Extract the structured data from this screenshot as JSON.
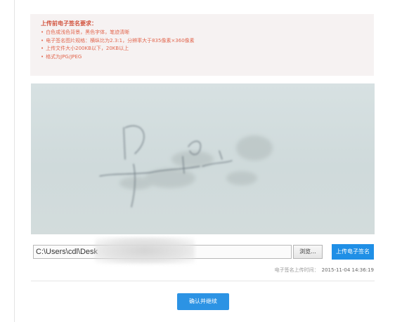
{
  "notice": {
    "title": "上传前电子签名要求：",
    "items": [
      "白色或浅色背景，黑色字体，笔迹清晰",
      "电子签名图片规格：横纵比为2.3:1，分辨率大于835像素×360像素",
      "上传文件大小200KB以下，20KB以上",
      "格式为JPG/JPEG"
    ]
  },
  "file": {
    "path_value": "C:\\Users\\cdl\\Desk"
  },
  "buttons": {
    "browse_label": "浏览...",
    "upload_label": "上传电子签名",
    "confirm_label": "确认并继续"
  },
  "upload_time": {
    "label": "电子签名上传时间：",
    "value": "2015-11-04 14:36:19"
  },
  "colors": {
    "notice_text": "#e2674f",
    "primary_button": "#1f8fe6"
  }
}
